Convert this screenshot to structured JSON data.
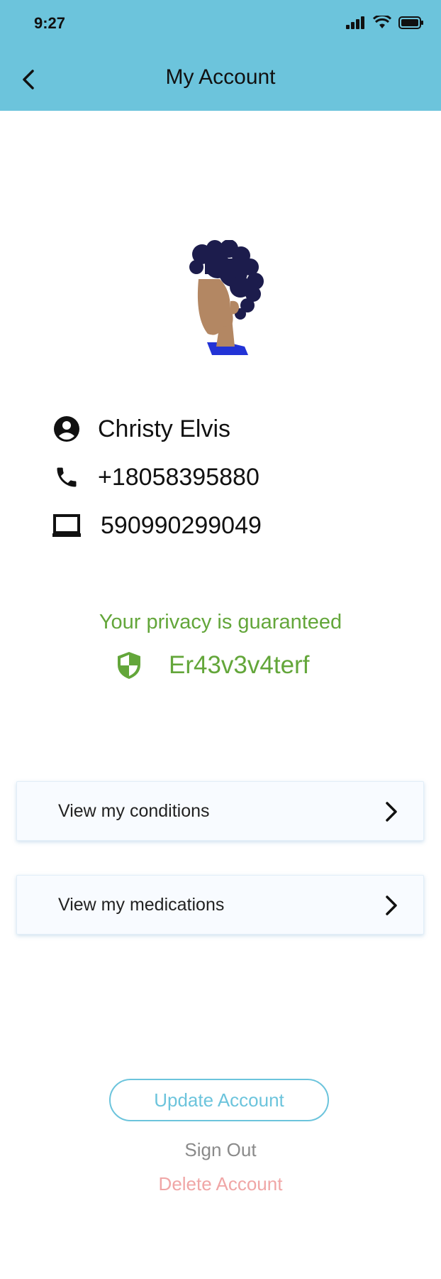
{
  "status_bar": {
    "time": "9:27"
  },
  "header": {
    "title": "My Account"
  },
  "profile": {
    "name": "Christy Elvis",
    "phone": "+18058395880",
    "id_number": "590990299049"
  },
  "privacy": {
    "title": "Your privacy is guaranteed",
    "code": "Er43v3v4terf"
  },
  "menu": [
    {
      "label": "View my conditions"
    },
    {
      "label": "View my medications"
    }
  ],
  "actions": {
    "update": "Update Account",
    "sign_out": "Sign Out",
    "delete": "Delete Account"
  },
  "colors": {
    "header_bg": "#6cc4dc",
    "privacy_green": "#63a63a",
    "delete_red": "#f0a6a6"
  }
}
